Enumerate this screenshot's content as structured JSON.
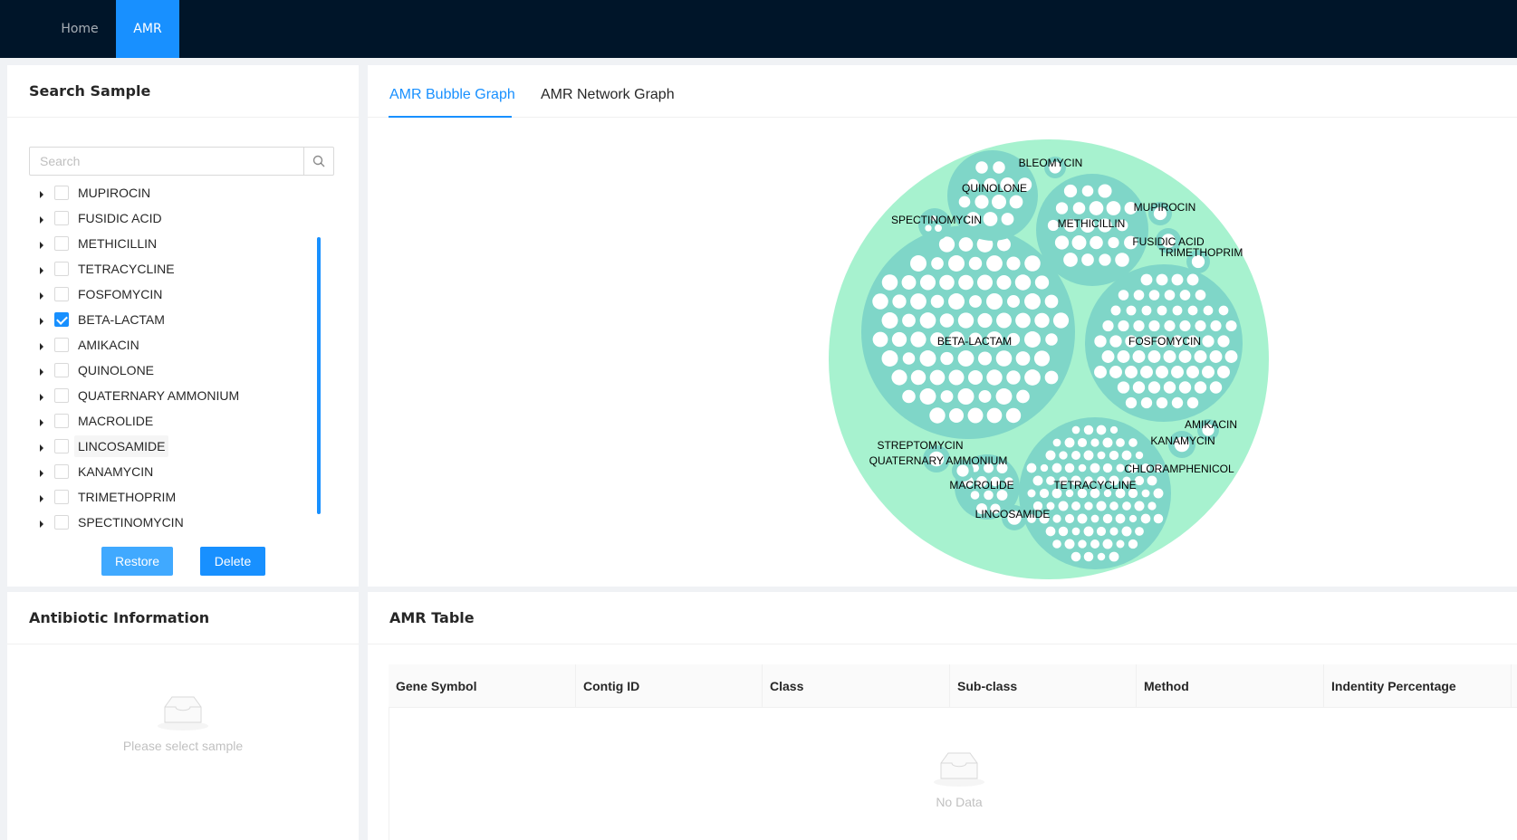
{
  "nav": {
    "items": [
      {
        "label": "Home",
        "active": false
      },
      {
        "label": "AMR",
        "active": true
      }
    ]
  },
  "search_panel": {
    "title": "Search Sample",
    "search_placeholder": "Search",
    "tree": [
      {
        "label": "MUPIROCIN",
        "checked": false
      },
      {
        "label": "FUSIDIC ACID",
        "checked": false
      },
      {
        "label": "METHICILLIN",
        "checked": false
      },
      {
        "label": "TETRACYCLINE",
        "checked": false
      },
      {
        "label": "FOSFOMYCIN",
        "checked": false
      },
      {
        "label": "BETA-LACTAM",
        "checked": true
      },
      {
        "label": "AMIKACIN",
        "checked": false
      },
      {
        "label": "QUINOLONE",
        "checked": false
      },
      {
        "label": "QUATERNARY AMMONIUM",
        "checked": false
      },
      {
        "label": "MACROLIDE",
        "checked": false
      },
      {
        "label": "LINCOSAMIDE",
        "checked": false
      },
      {
        "label": "KANAMYCIN",
        "checked": false
      },
      {
        "label": "TRIMETHOPRIM",
        "checked": false
      },
      {
        "label": "SPECTINOMYCIN",
        "checked": false
      }
    ],
    "restore_label": "Restore",
    "delete_label": "Delete"
  },
  "graph_panel": {
    "tabs": [
      {
        "label": "AMR Bubble Graph",
        "active": true
      },
      {
        "label": "AMR Network Graph",
        "active": false
      }
    ],
    "bubble_labels": {
      "bleomycin": "BLEOMYCIN",
      "quinolone": "QUINOLONE",
      "mupirocin": "MUPIROCIN",
      "spectinomycin": "SPECTINOMYCIN",
      "methicillin": "METHICILLIN",
      "fusidic_acid": "FUSIDIC ACID",
      "trimethoprim": "TRIMETHOPRIM",
      "beta_lactam": "BETA-LACTAM",
      "fosfomycin": "FOSFOMYCIN",
      "amikacin": "AMIKACIN",
      "kanamycin": "KANAMYCIN",
      "streptomycin": "STREPTOMYCIN",
      "quaternary_ammonium": "QUATERNARY AMMONIUM",
      "chloramphenicol": "CHLORAMPHENICOL",
      "macrolide": "MACROLIDE",
      "tetracycline": "TETRACYCLINE",
      "lincosamide": "LINCOSAMIDE"
    },
    "colors": {
      "outer": "#a7f2cf",
      "group": "#7fd6c8",
      "leaf": "#ffffff"
    }
  },
  "antibiotic_panel": {
    "title": "Antibiotic Information",
    "empty_text": "Please select sample"
  },
  "table_panel": {
    "title": "AMR Table",
    "columns": [
      "Gene Symbol",
      "Contig ID",
      "Class",
      "Sub-class",
      "Method",
      "Indentity Percentage"
    ],
    "empty_text": "No Data"
  },
  "colors": {
    "primary": "#1890ff",
    "header_bg": "#001529",
    "restore_btn": "#40a9ff"
  }
}
